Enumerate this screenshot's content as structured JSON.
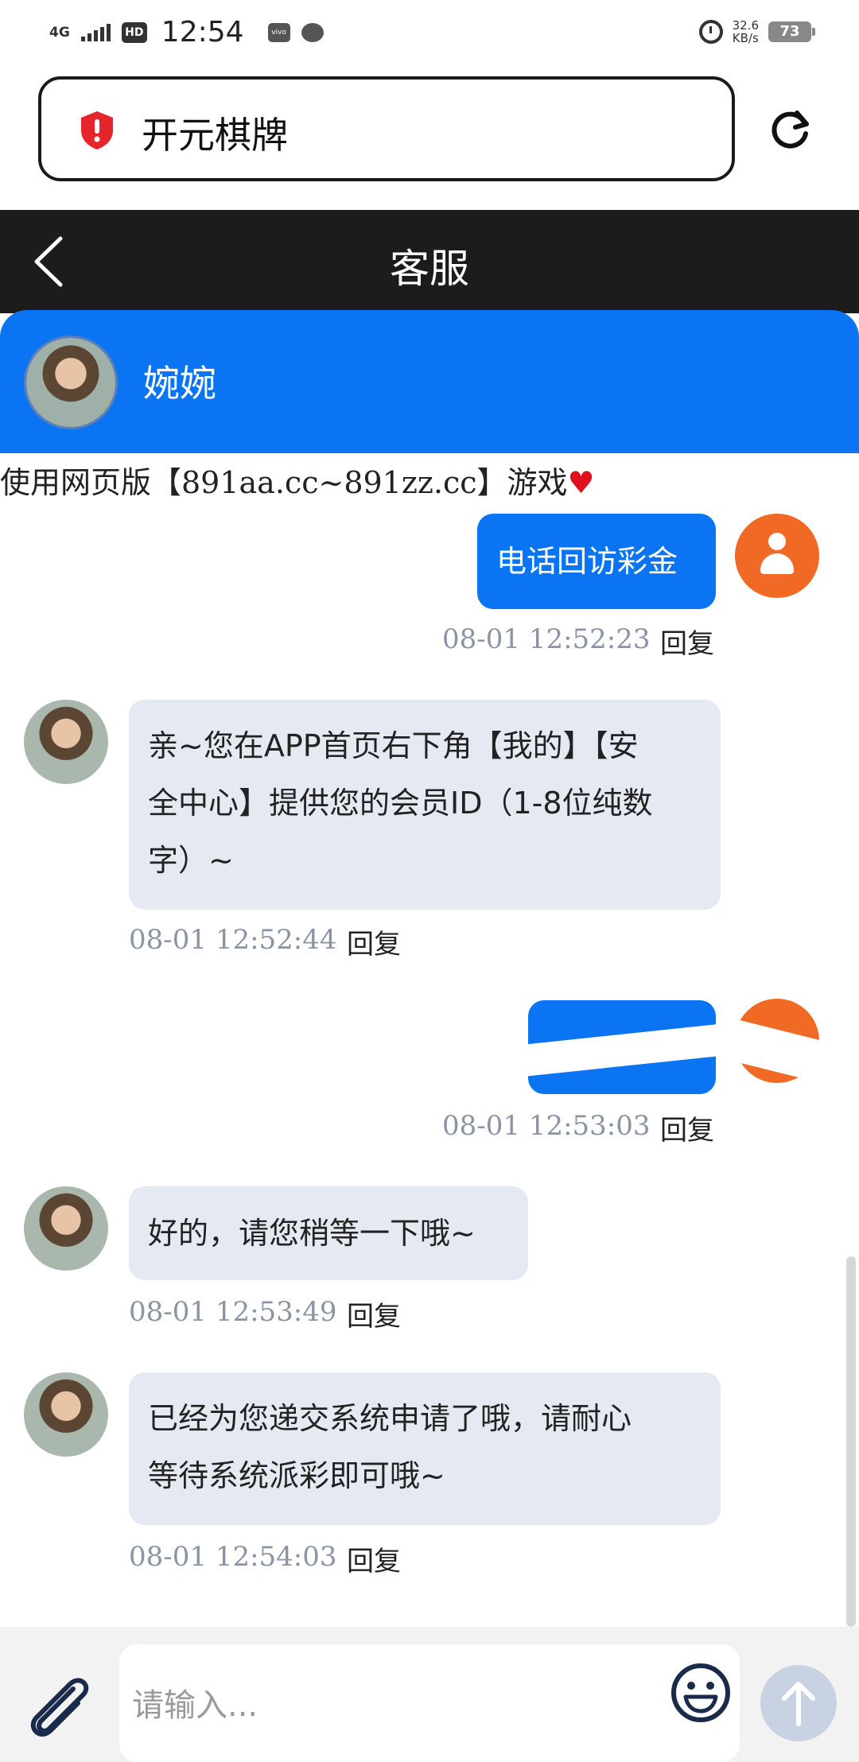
{
  "status_bar": {
    "network": "4G",
    "hd_badge": "HD",
    "time": "12:54",
    "vivo_icon_label": "vivo",
    "speed_value": "32.6",
    "speed_unit": "KB/s",
    "battery": "73"
  },
  "browser": {
    "url_text": "开元棋牌"
  },
  "header": {
    "title": "客服"
  },
  "agent": {
    "name": "婉婉"
  },
  "notice": {
    "text": "使用网页版【891aa.cc~891zz.cc】游戏",
    "emoji": "♥"
  },
  "messages": [
    {
      "side": "out",
      "text": "电话回访彩金",
      "time": "08-01 12:52:23",
      "reply": "回复"
    },
    {
      "side": "in",
      "text_lines": [
        "亲~您在APP首页右下角【我的】【安",
        "全中心】提供您的会员ID（1-8位纯数",
        "字）~"
      ],
      "time": "08-01 12:52:44",
      "reply": "回复"
    },
    {
      "side": "out",
      "text": "",
      "time": "08-01 12:53:03",
      "reply": "回复"
    },
    {
      "side": "in",
      "text": "好的，请您稍等一下哦~",
      "time": "08-01 12:53:49",
      "reply": "回复"
    },
    {
      "side": "in",
      "text_lines": [
        "已经为您递交系统申请了哦，请耐心",
        "等待系统派彩即可哦~"
      ],
      "time": "08-01 12:54:03",
      "reply": "回复"
    }
  ],
  "input": {
    "placeholder": "请输入..."
  },
  "colors": {
    "brand_blue": "#0a74f2",
    "user_avatar": "#f06a26",
    "incoming_bubble": "#e5e9f2",
    "header_bg": "#1c1c1c"
  }
}
